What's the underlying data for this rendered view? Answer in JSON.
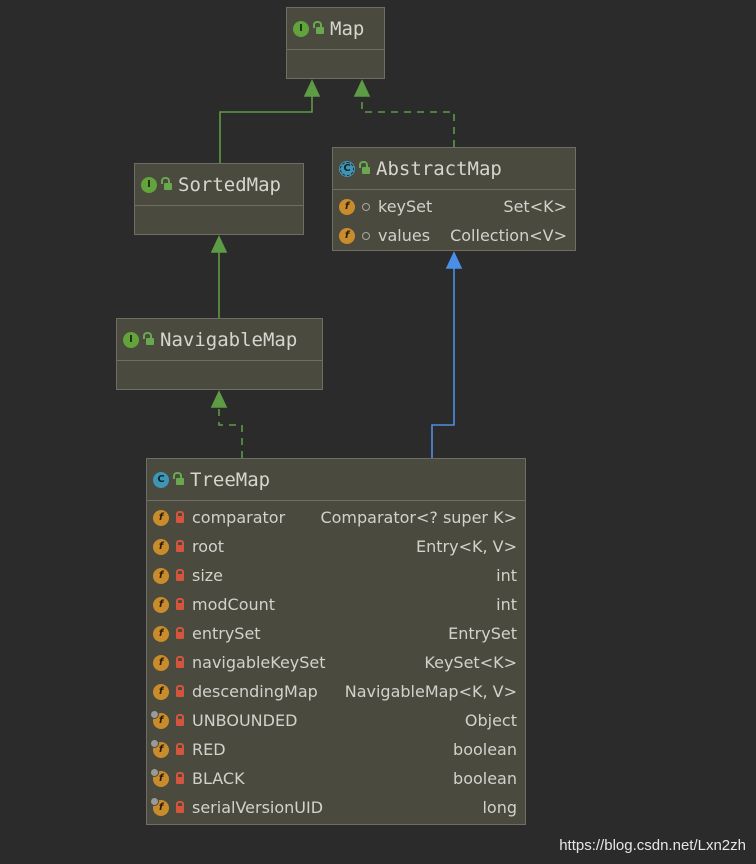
{
  "colors": {
    "generalization": "#5d9b45",
    "realization": "#5d9b45",
    "extends_class": "#4a8fe7"
  },
  "nodes": {
    "map": {
      "title": "Map",
      "kind": "interface",
      "icon": "interface-icon"
    },
    "sorted_map": {
      "title": "SortedMap",
      "kind": "interface",
      "icon": "interface-icon"
    },
    "abstract_map": {
      "title": "AbstractMap",
      "kind": "abstract-class",
      "icon": "abstract-class-icon",
      "fields": [
        {
          "name": "keySet",
          "type": "Set<K>",
          "visibility": "package"
        },
        {
          "name": "values",
          "type": "Collection<V>",
          "visibility": "package"
        }
      ]
    },
    "navigable_map": {
      "title": "NavigableMap",
      "kind": "interface",
      "icon": "interface-icon"
    },
    "tree_map": {
      "title": "TreeMap",
      "kind": "class",
      "icon": "class-icon",
      "fields": [
        {
          "name": "comparator",
          "type": "Comparator<? super K>",
          "static": false
        },
        {
          "name": "root",
          "type": "Entry<K, V>",
          "static": false
        },
        {
          "name": "size",
          "type": "int",
          "static": false
        },
        {
          "name": "modCount",
          "type": "int",
          "static": false
        },
        {
          "name": "entrySet",
          "type": "EntrySet",
          "static": false
        },
        {
          "name": "navigableKeySet",
          "type": "KeySet<K>",
          "static": false
        },
        {
          "name": "descendingMap",
          "type": "NavigableMap<K, V>",
          "static": false
        },
        {
          "name": "UNBOUNDED",
          "type": "Object",
          "static": true
        },
        {
          "name": "RED",
          "type": "boolean",
          "static": true
        },
        {
          "name": "BLACK",
          "type": "boolean",
          "static": true
        },
        {
          "name": "serialVersionUID",
          "type": "long",
          "static": true
        }
      ]
    }
  },
  "edges": [
    {
      "from": "sorted_map",
      "to": "map",
      "style": "solid",
      "color": "#5d9b45"
    },
    {
      "from": "abstract_map",
      "to": "map",
      "style": "dashed",
      "color": "#5d9b45"
    },
    {
      "from": "navigable_map",
      "to": "sorted_map",
      "style": "solid",
      "color": "#5d9b45"
    },
    {
      "from": "tree_map",
      "to": "navigable_map",
      "style": "dashed",
      "color": "#5d9b45"
    },
    {
      "from": "tree_map",
      "to": "abstract_map",
      "style": "solid",
      "color": "#4a8fe7"
    }
  ],
  "watermark": "https://blog.csdn.net/Lxn2zh"
}
